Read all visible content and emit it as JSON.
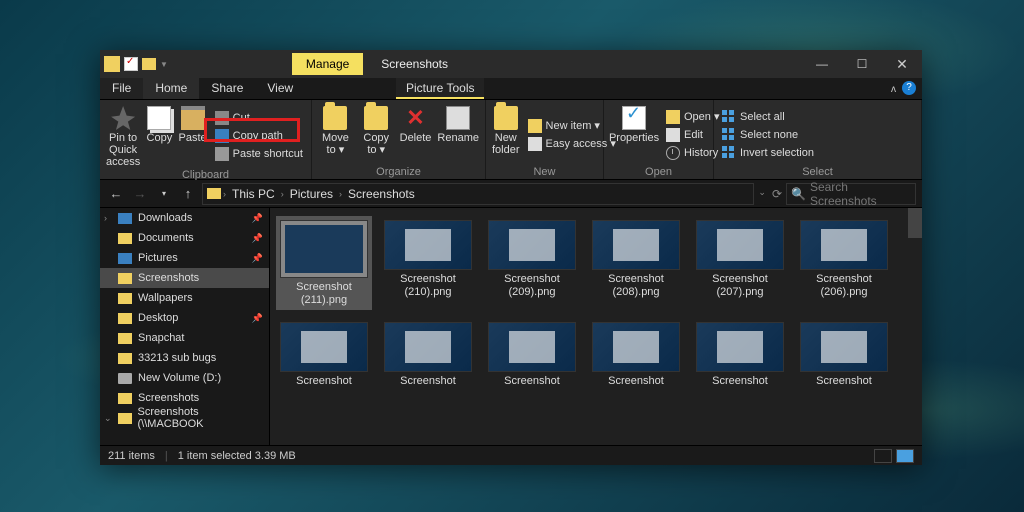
{
  "titlebar": {
    "manage_tab": "Manage",
    "title": "Screenshots"
  },
  "menu": {
    "file": "File",
    "home": "Home",
    "share": "Share",
    "view": "View",
    "picture_tools": "Picture Tools"
  },
  "ribbon": {
    "clipboard": {
      "label": "Clipboard",
      "pin": "Pin to Quick access",
      "copy": "Copy",
      "paste": "Paste",
      "cut": "Cut",
      "copy_path": "Copy path",
      "paste_shortcut": "Paste shortcut"
    },
    "organize": {
      "label": "Organize",
      "move_to": "Move to ▾",
      "copy_to": "Copy to ▾",
      "delete": "Delete",
      "rename": "Rename"
    },
    "new": {
      "label": "New",
      "new_folder": "New folder",
      "new_item": "New item ▾",
      "easy_access": "Easy access ▾"
    },
    "open": {
      "label": "Open",
      "properties": "Properties",
      "open": "Open ▾",
      "edit": "Edit",
      "history": "History"
    },
    "select": {
      "label": "Select",
      "select_all": "Select all",
      "select_none": "Select none",
      "invert": "Invert selection"
    }
  },
  "address": {
    "crumbs": [
      "This PC",
      "Pictures",
      "Screenshots"
    ],
    "search_placeholder": "Search Screenshots"
  },
  "nav": {
    "items": [
      {
        "label": "Downloads",
        "icon": "blue",
        "pinned": true,
        "expand": ">"
      },
      {
        "label": "Documents",
        "icon": "folder",
        "pinned": true
      },
      {
        "label": "Pictures",
        "icon": "blue",
        "pinned": true
      },
      {
        "label": "Screenshots",
        "icon": "folder",
        "selected": true
      },
      {
        "label": "Wallpapers",
        "icon": "folder"
      },
      {
        "label": "Desktop",
        "icon": "folder",
        "pinned": true
      },
      {
        "label": "Snapchat",
        "icon": "folder"
      },
      {
        "label": "33213 sub bugs",
        "icon": "folder"
      },
      {
        "label": "New Volume (D:)",
        "icon": "drive"
      },
      {
        "label": "Screenshots",
        "icon": "folder"
      },
      {
        "label": "Screenshots (\\\\MACBOOK",
        "icon": "folder",
        "expand": "v"
      }
    ]
  },
  "files": [
    {
      "label": "Screenshot (211).png",
      "selected": true
    },
    {
      "label": "Screenshot (210).png"
    },
    {
      "label": "Screenshot (209).png"
    },
    {
      "label": "Screenshot (208).png"
    },
    {
      "label": "Screenshot (207).png"
    },
    {
      "label": "Screenshot (206).png"
    },
    {
      "label": "Screenshot"
    },
    {
      "label": "Screenshot"
    },
    {
      "label": "Screenshot"
    },
    {
      "label": "Screenshot"
    },
    {
      "label": "Screenshot"
    },
    {
      "label": "Screenshot"
    }
  ],
  "status": {
    "count": "211 items",
    "selected": "1 item selected  3.39 MB"
  }
}
